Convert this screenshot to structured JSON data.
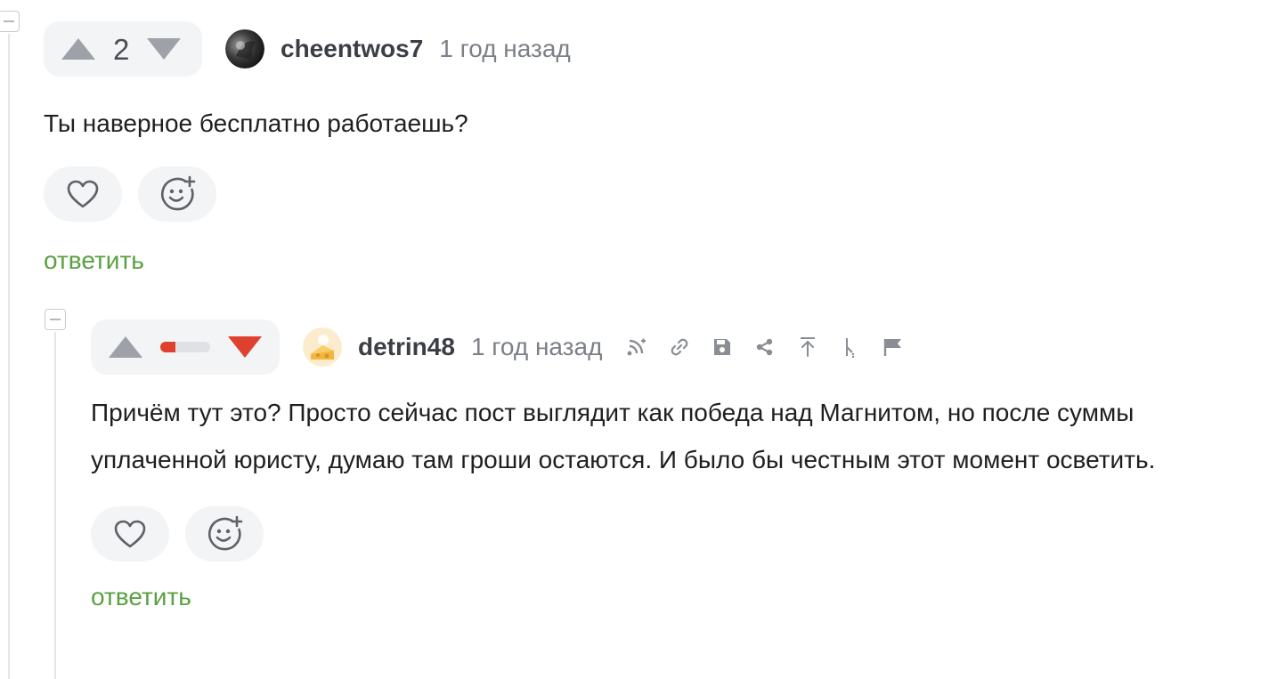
{
  "comments": [
    {
      "username": "cheentwos7",
      "time": "1 год назад",
      "score": "2",
      "text": "Ты наверное бесплатно работаешь?",
      "reply_label": "ответить",
      "avatar_icon": "dark-avatar-icon"
    },
    {
      "username": "detrin48",
      "time": "1 год назад",
      "score_visual": "negative-rating-bar",
      "rating_fill_fraction": 0.3,
      "text": "Причём тут это? Просто сейчас пост выглядит как победа над Магнитом, но после суммы уплаченной юристу, думаю там гроши остаются. И было бы честным этот момент осветить.",
      "reply_label": "ответить",
      "avatar_icon": "cheese-avatar-icon",
      "tools": [
        "branch-icon",
        "link-icon",
        "save-icon",
        "share-icon",
        "go-to-parent-icon",
        "hide-branch-icon",
        "flag-icon"
      ]
    }
  ],
  "colors": {
    "accent_green": "#5aa041",
    "downvote_red": "#e0412f",
    "vote_gray": "#9ea2a8",
    "pill_bg": "#f3f4f6"
  }
}
